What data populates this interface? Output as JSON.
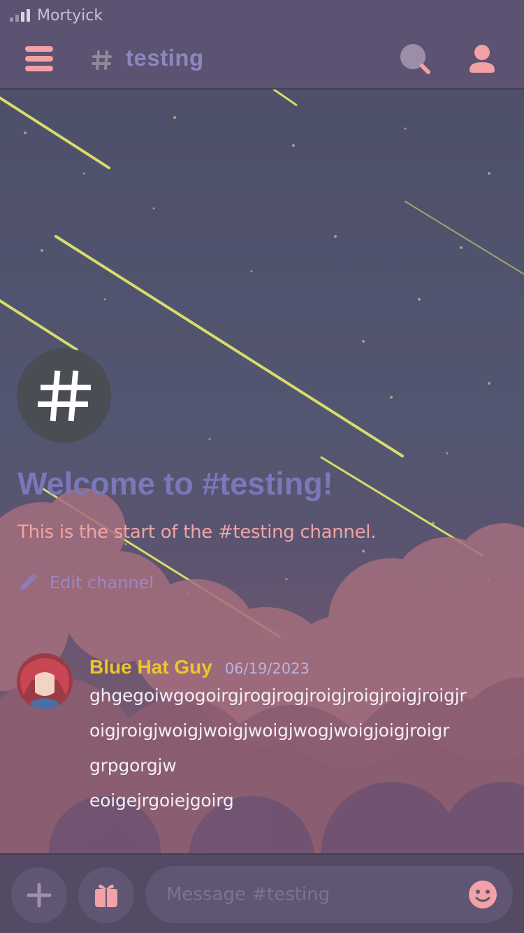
{
  "status_bar": {
    "carrier": "Mortyick"
  },
  "header": {
    "channel_name": "testing"
  },
  "channel_intro": {
    "avatar_glyph": "#",
    "title": "Welcome to #testing!",
    "subtitle": "This is the start of the #testing channel.",
    "edit_label": "Edit channel"
  },
  "message": {
    "username": "Blue Hat Guy",
    "timestamp": "06/19/2023",
    "lines": [
      "ghgegoiwgogoirgjrogjrogjroigjroigjroigjroigjr",
      "oigjroigjwoigjwoigjwoigjwogjwoigjoigjroigr",
      "grpgorgjw",
      "eoigejrgoiejgoirg"
    ]
  },
  "composer": {
    "placeholder": "Message #testing"
  },
  "colors": {
    "accent_pink": "#f2a2a6",
    "channel_name": "#8a88be",
    "username": "#f0c52a",
    "welcome_title": "#7a78b8"
  },
  "icons": {
    "menu": "menu-icon",
    "channel": "hash-icon",
    "search": "search-icon",
    "profile": "person-icon",
    "edit": "pencil-icon",
    "add": "plus-icon",
    "gift": "gift-icon",
    "emoji": "smiley-icon"
  }
}
